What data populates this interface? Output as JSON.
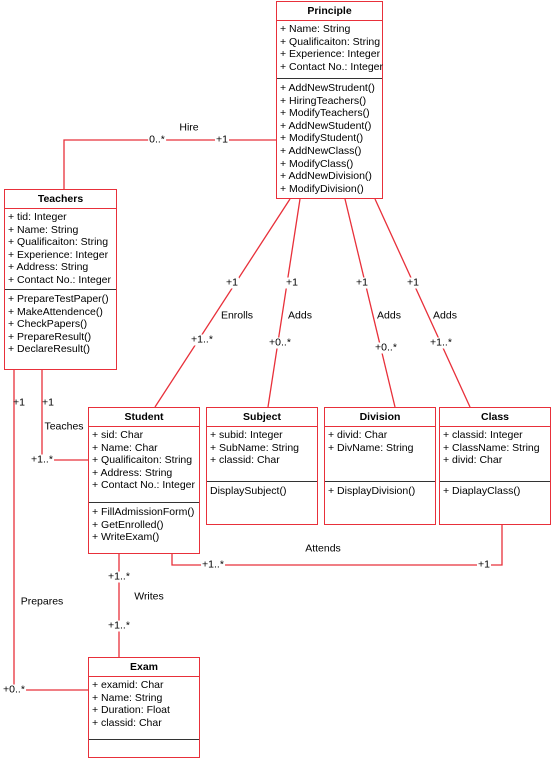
{
  "classes": {
    "principle": {
      "name": "Principle",
      "attributes": [
        "+ Name: String",
        "+ Qualificaiton: String",
        "+ Experience: Integer",
        "+ Contact No.: Integer"
      ],
      "methods": [
        "+ AddNewStrudent()",
        "+ HiringTeachers()",
        "+ ModifyTeachers()",
        "+ AddNewStudent()",
        "+ ModifyStudent()",
        "+ AddNewClass()",
        "+ ModifyClass()",
        "+ AddNewDivision()",
        "+ ModifyDivision()"
      ]
    },
    "teachers": {
      "name": "Teachers",
      "attributes": [
        "+ tid: Integer",
        "+ Name: String",
        "+ Qualificaiton: String",
        "+ Experience: Integer",
        "+ Address: String",
        "+ Contact No.: Integer"
      ],
      "methods": [
        "+ PrepareTestPaper()",
        "+ MakeAttendence()",
        "+ CheckPapers()",
        "+ PrepareResult()",
        "+ DeclareResult()"
      ]
    },
    "student": {
      "name": "Student",
      "attributes": [
        "+ sid: Char",
        "+ Name: Char",
        "+ Qualificaiton: String",
        "+ Address: String",
        "+ Contact No.: Integer"
      ],
      "methods": [
        "+ FillAdmissionForm()",
        "+ GetEnrolled()",
        "+ WriteExam()"
      ]
    },
    "subject": {
      "name": "Subject",
      "attributes": [
        "+ subid: Integer",
        "+ SubName: String",
        "+ classid: Char"
      ],
      "methods": [
        "DisplaySubject()"
      ]
    },
    "division": {
      "name": "Division",
      "attributes": [
        "+ divid: Char",
        "+ DivName: String"
      ],
      "methods": [
        "+ DisplayDivision()"
      ]
    },
    "class": {
      "name": "Class",
      "attributes": [
        "+ classid: Integer",
        "+ ClassName: String",
        "+ divid: Char"
      ],
      "methods": [
        "+ DiaplayClass()"
      ]
    },
    "exam": {
      "name": "Exam",
      "attributes": [
        "+ examid: Char",
        "+ Name: String",
        "+ Duration: Float",
        "+ classid: Char"
      ],
      "methods": []
    }
  },
  "associations": {
    "hire": {
      "label": "Hire",
      "from_mult": "0..*",
      "to_mult": "+1"
    },
    "enrolls": {
      "label": "Enrolls",
      "from_mult": "+1",
      "to_mult": "+1..*"
    },
    "adds_subject": {
      "label": "Adds",
      "from_mult": "+1",
      "to_mult": "+0..*"
    },
    "adds_division": {
      "label": "Adds",
      "from_mult": "+1",
      "to_mult": "+0..*"
    },
    "adds_class": {
      "label": "Adds",
      "from_mult": "+1",
      "to_mult": "+1..*"
    },
    "teaches": {
      "label": "Teaches",
      "from_mult": "+1",
      "to_mult": "+1..*"
    },
    "prepares": {
      "label": "Prepares",
      "from_mult": "+1",
      "to_mult": "+0..*"
    },
    "attends": {
      "label": "Attends",
      "from_mult": "+1..*",
      "to_mult": "+1"
    },
    "writes": {
      "label": "Writes",
      "from_mult": "+1..*",
      "to_mult": "+1..*"
    }
  },
  "colors": {
    "line": "#e8303a",
    "divider": "#333333"
  }
}
